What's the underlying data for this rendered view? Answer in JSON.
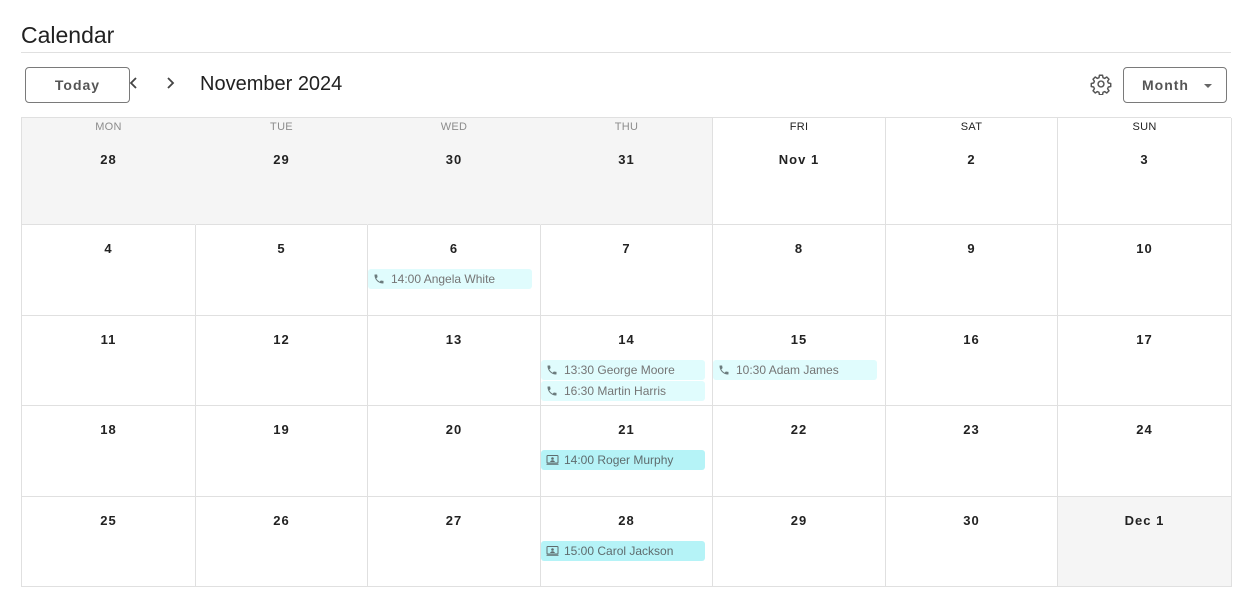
{
  "page": {
    "title": "Calendar"
  },
  "toolbar": {
    "today_label": "Today",
    "month_label": "November 2024",
    "view_label": "Month",
    "icons": {
      "prev": "chevron-left-icon",
      "next": "chevron-right-icon",
      "settings": "gear-icon"
    }
  },
  "colors": {
    "accent_today": "#1a73e8",
    "outside_month_bg": "#f5f5f5",
    "call_event_bg": "#e0fcfd",
    "meeting_event_bg": "#b5f3f7",
    "border": "#e0e0e0"
  },
  "weekdays": [
    "MON",
    "TUE",
    "WED",
    "THU",
    "FRI",
    "SAT",
    "SUN"
  ],
  "today_weekday": "THU",
  "weeks": [
    {
      "days": [
        {
          "label": "28",
          "outside": true,
          "events": []
        },
        {
          "label": "29",
          "outside": true,
          "events": []
        },
        {
          "label": "30",
          "outside": true,
          "events": []
        },
        {
          "label": "31",
          "outside": true,
          "events": []
        },
        {
          "label": "Nov 1",
          "outside": false,
          "events": []
        },
        {
          "label": "2",
          "outside": false,
          "events": []
        },
        {
          "label": "3",
          "outside": false,
          "events": []
        }
      ]
    },
    {
      "days": [
        {
          "label": "4",
          "outside": false,
          "events": []
        },
        {
          "label": "5",
          "outside": false,
          "events": []
        },
        {
          "label": "6",
          "outside": false,
          "events": [
            {
              "text": "14:00 Angela White",
              "type": "call",
              "icon": "phone-icon"
            }
          ]
        },
        {
          "label": "7",
          "outside": false,
          "events": []
        },
        {
          "label": "8",
          "outside": false,
          "events": []
        },
        {
          "label": "9",
          "outside": false,
          "events": []
        },
        {
          "label": "10",
          "outside": false,
          "events": []
        }
      ]
    },
    {
      "days": [
        {
          "label": "11",
          "outside": false,
          "events": []
        },
        {
          "label": "12",
          "outside": false,
          "events": []
        },
        {
          "label": "13",
          "outside": false,
          "events": []
        },
        {
          "label": "14",
          "outside": false,
          "events": [
            {
              "text": "13:30 George Moore",
              "type": "call",
              "icon": "phone-icon"
            },
            {
              "text": "16:30 Martin Harris",
              "type": "call",
              "icon": "phone-icon"
            }
          ]
        },
        {
          "label": "15",
          "outside": false,
          "events": [
            {
              "text": "10:30 Adam James",
              "type": "call",
              "icon": "phone-icon"
            }
          ]
        },
        {
          "label": "16",
          "outside": false,
          "events": []
        },
        {
          "label": "17",
          "outside": false,
          "events": []
        }
      ]
    },
    {
      "days": [
        {
          "label": "18",
          "outside": false,
          "events": []
        },
        {
          "label": "19",
          "outside": false,
          "events": []
        },
        {
          "label": "20",
          "outside": false,
          "events": []
        },
        {
          "label": "21",
          "outside": false,
          "events": [
            {
              "text": "14:00 Roger Murphy",
              "type": "meeting",
              "icon": "video-meeting-icon"
            }
          ]
        },
        {
          "label": "22",
          "outside": false,
          "events": []
        },
        {
          "label": "23",
          "outside": false,
          "events": []
        },
        {
          "label": "24",
          "outside": false,
          "events": []
        }
      ]
    },
    {
      "days": [
        {
          "label": "25",
          "outside": false,
          "events": []
        },
        {
          "label": "26",
          "outside": false,
          "events": []
        },
        {
          "label": "27",
          "outside": false,
          "events": []
        },
        {
          "label": "28",
          "outside": false,
          "events": [
            {
              "text": "15:00 Carol Jackson",
              "type": "meeting",
              "icon": "video-meeting-icon"
            }
          ]
        },
        {
          "label": "29",
          "outside": false,
          "events": []
        },
        {
          "label": "30",
          "outside": false,
          "events": []
        },
        {
          "label": "Dec 1",
          "outside": true,
          "events": []
        }
      ]
    }
  ]
}
